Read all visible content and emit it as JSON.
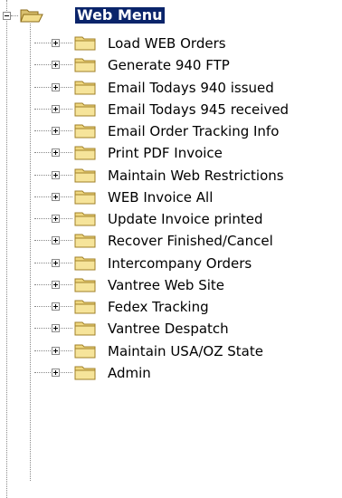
{
  "root": {
    "label": "Web Menu",
    "icon": "open-folder-icon",
    "expanded": true,
    "selected": true
  },
  "items": [
    {
      "label": "Load WEB Orders",
      "icon": "folder-icon"
    },
    {
      "label": "Generate 940 FTP",
      "icon": "folder-icon"
    },
    {
      "label": "Email Todays 940 issued",
      "icon": "folder-icon"
    },
    {
      "label": "Email Todays 945 received",
      "icon": "folder-icon"
    },
    {
      "label": "Email Order Tracking Info",
      "icon": "folder-icon"
    },
    {
      "label": "Print PDF Invoice",
      "icon": "folder-icon"
    },
    {
      "label": "Maintain Web Restrictions",
      "icon": "folder-icon"
    },
    {
      "label": "WEB Invoice All",
      "icon": "folder-icon"
    },
    {
      "label": "Update Invoice printed",
      "icon": "folder-icon"
    },
    {
      "label": "Recover Finished/Cancel",
      "icon": "folder-icon"
    },
    {
      "label": "Intercompany Orders",
      "icon": "folder-icon"
    },
    {
      "label": "Vantree Web Site",
      "icon": "folder-icon"
    },
    {
      "label": "Fedex Tracking",
      "icon": "folder-icon"
    },
    {
      "label": "Vantree Despatch",
      "icon": "folder-icon"
    },
    {
      "label": "Maintain USA/OZ State",
      "icon": "folder-icon"
    },
    {
      "label": "Admin",
      "icon": "folder-icon"
    }
  ],
  "colors": {
    "selection_bg": "#0a246a",
    "folder_fill": "#f0d880",
    "folder_stroke": "#a08028",
    "guide_line": "#8a8a8a"
  }
}
